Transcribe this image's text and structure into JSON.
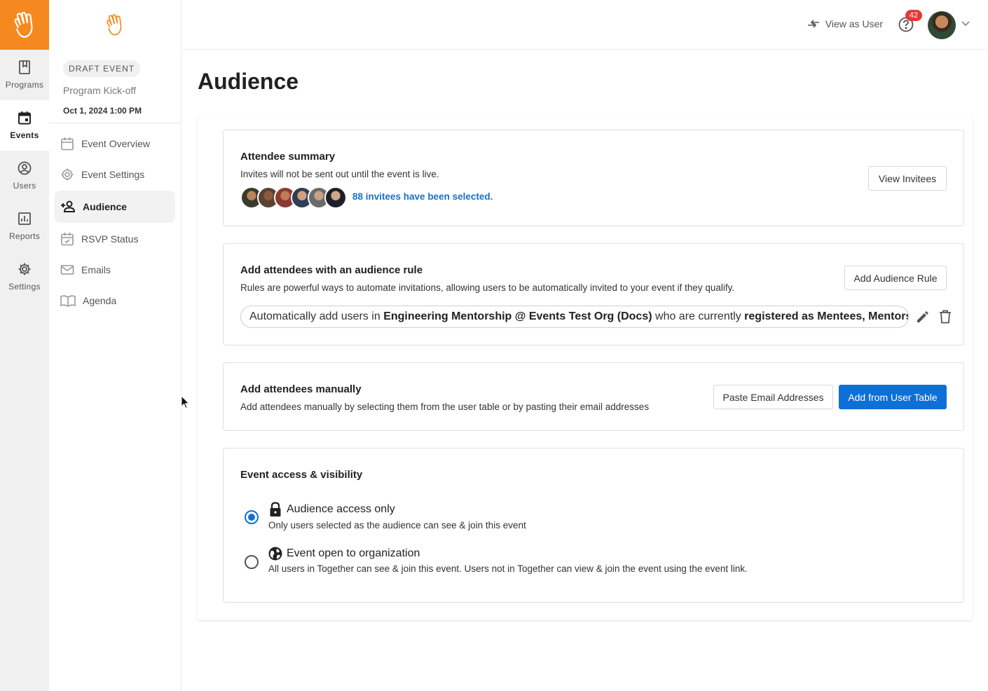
{
  "rail": {
    "items": [
      {
        "label": "Programs",
        "icon": "book-icon"
      },
      {
        "label": "Events",
        "icon": "calendar-icon",
        "active": true
      },
      {
        "label": "Users",
        "icon": "user-circle-icon"
      },
      {
        "label": "Reports",
        "icon": "bar-chart-icon"
      },
      {
        "label": "Settings",
        "icon": "gear-icon"
      }
    ]
  },
  "event": {
    "status": "DRAFT EVENT",
    "name": "Program Kick-off",
    "date": "Oct 1, 2024 1:00 PM"
  },
  "side_menu": [
    {
      "label": "Event Overview",
      "icon": "calendar-icon"
    },
    {
      "label": "Event Settings",
      "icon": "gear-icon"
    },
    {
      "label": "Audience",
      "icon": "person-add-icon",
      "active": true
    },
    {
      "label": "RSVP Status",
      "icon": "calendar-check-icon"
    },
    {
      "label": "Emails",
      "icon": "mail-icon"
    },
    {
      "label": "Agenda",
      "icon": "book-open-icon"
    }
  ],
  "topbar": {
    "view_as_user": "View as User",
    "help_badge": "42"
  },
  "page": {
    "title": "Audience"
  },
  "summary": {
    "title": "Attendee summary",
    "desc": "Invites will not be sent out until the event is live.",
    "invitees_text": "88 invitees have been selected.",
    "view_button": "View Invitees"
  },
  "rule": {
    "title": "Add attendees with an audience rule",
    "desc": "Rules are powerful ways to automate invitations, allowing users to be automatically invited to your event if they qualify.",
    "add_button": "Add Audience Rule",
    "pill_prefix": "Automatically add users in ",
    "pill_program": "Engineering Mentorship @ Events Test Org (Docs)",
    "pill_middle": " who are currently ",
    "pill_roles": "registered as Mentees, Mentors"
  },
  "manual": {
    "title": "Add attendees manually",
    "desc": "Add attendees manually by selecting them from the user table or by pasting their email addresses",
    "paste_button": "Paste Email Addresses",
    "add_button": "Add from User Table"
  },
  "access": {
    "title": "Event access & visibility",
    "options": [
      {
        "label": "Audience access only",
        "desc": "Only users selected as the audience can see & join this event",
        "icon": "lock-icon",
        "selected": true
      },
      {
        "label": "Event open to organization",
        "desc": "All users in Together can see & join this event. Users not in Together can view & join the event using the event link.",
        "icon": "globe-icon",
        "selected": false
      }
    ]
  },
  "colors": {
    "brand": "#f5891f",
    "primary": "#0f6fd8",
    "link": "#1a6fc9",
    "badge": "#e53935"
  }
}
